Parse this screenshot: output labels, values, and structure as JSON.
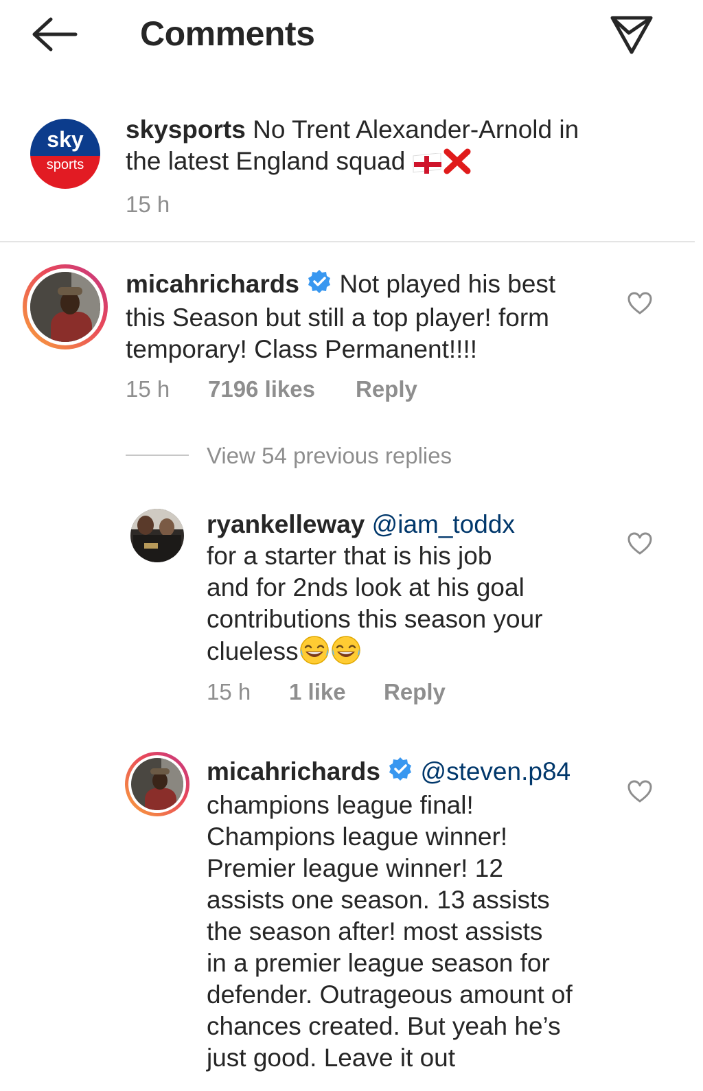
{
  "header": {
    "title": "Comments"
  },
  "post": {
    "brand_top": "sky",
    "brand_bottom": "sports",
    "username": "skysports",
    "caption_line1": "No Trent Alexander-Arnold in",
    "caption_line2": "the latest England squad",
    "time": "15 h"
  },
  "comments": [
    {
      "username": "micahrichards",
      "text_line1": "Not played his best",
      "text_line2": "this Season but still a top player! form",
      "text_line3": "temporary! Class Permanent!!!!",
      "time": "15 h",
      "likes": "7196 likes",
      "reply": "Reply",
      "view_replies": "View 54 previous replies"
    }
  ],
  "replies": [
    {
      "username": "ryankelleway",
      "mention": "@iam_toddx",
      "lines": [
        "for a starter that is his job",
        "and for 2nds look at his goal",
        "contributions this season your",
        "clueless"
      ],
      "time": "15 h",
      "likes": "1 like",
      "reply": "Reply"
    },
    {
      "username": "micahrichards",
      "mention": "@steven.p84",
      "lines": [
        "champions league final!",
        "Champions league winner!",
        "Premier league winner! 12",
        "assists one season. 13 assists",
        "the season after!  most assists",
        "in a premier league season for",
        "defender. Outrageous amount of",
        "chances created. But yeah he’s",
        "just good. Leave it out"
      ]
    }
  ],
  "colors": {
    "verified": "#3897f0",
    "mention": "#00376b",
    "muted": "#8e8e8e",
    "sky_blue": "#0c3c8c",
    "sky_red": "#e21b23"
  }
}
